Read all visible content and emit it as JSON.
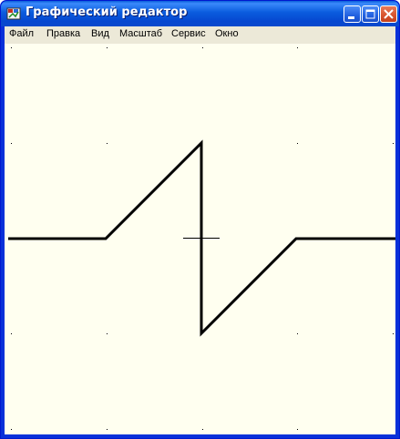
{
  "window": {
    "title": "Графический редактор",
    "buttons": {
      "minimize_icon": "minimize-icon",
      "maximize_icon": "maximize-icon",
      "close_icon": "close-icon"
    }
  },
  "menu": {
    "items": [
      "Файл",
      "Правка",
      "Вид",
      "Масштаб",
      "Сервис",
      "Окно"
    ]
  },
  "canvas": {
    "background_color": "#fffff0",
    "line_color": "#000000",
    "grid_dot_color": "#000000",
    "shape": "polyline",
    "cursor": "crosshair"
  }
}
